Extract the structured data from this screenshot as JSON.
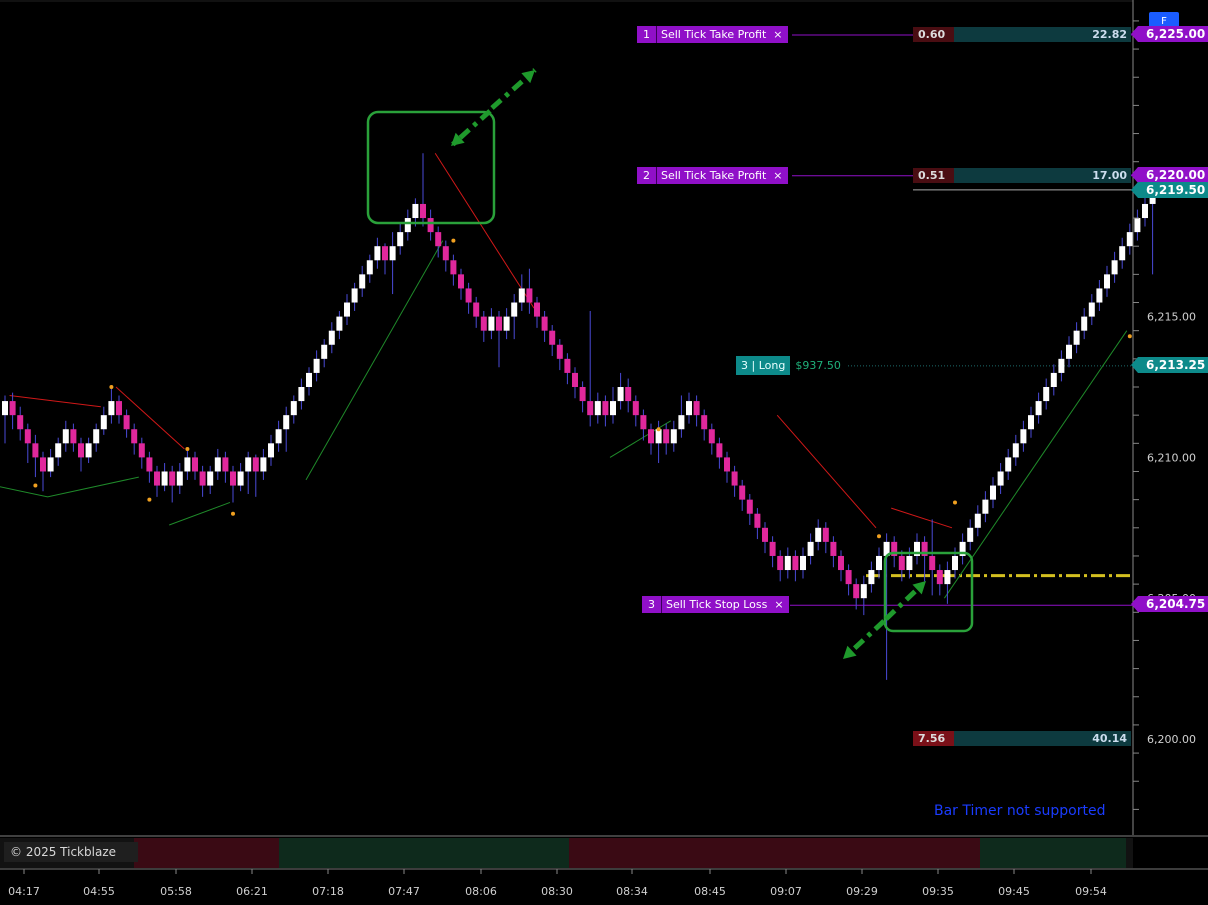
{
  "chart_data": {
    "type": "renko-candlestick",
    "instrument_price_axis": {
      "tick_labels": [
        "6,225.00",
        "6,220.00",
        "6,215.00",
        "6,210.00",
        "6,205.00",
        "6,200.00"
      ],
      "ticks": [
        6225,
        6220,
        6215,
        6210,
        6205,
        6200
      ],
      "ylim": [
        6198.2,
        6226.2
      ]
    },
    "time_axis": {
      "tick_labels": [
        "04:17",
        "04:55",
        "05:58",
        "06:21",
        "07:18",
        "07:47",
        "08:06",
        "08:30",
        "08:34",
        "08:45",
        "09:07",
        "09:29",
        "09:35",
        "09:45",
        "09:54"
      ]
    },
    "bars": [
      [
        6211.5,
        6212.0,
        6212.2,
        6210.5,
        "up"
      ],
      [
        6212.0,
        6211.5,
        6212.3,
        6211.0,
        "down"
      ],
      [
        6211.5,
        6211.0,
        6211.8,
        6210.6,
        "down"
      ],
      [
        6211.0,
        6210.5,
        6211.2,
        6209.8,
        "down"
      ],
      [
        6210.5,
        6210.0,
        6210.8,
        6209.3,
        "down"
      ],
      [
        6210.0,
        6209.5,
        6210.2,
        6208.8,
        "down"
      ],
      [
        6209.5,
        6210.0,
        6210.3,
        6209.3,
        "up"
      ],
      [
        6210.0,
        6210.5,
        6210.7,
        6209.7,
        "up"
      ],
      [
        6210.5,
        6211.0,
        6211.3,
        6210.2,
        "up"
      ],
      [
        6211.0,
        6210.5,
        6211.2,
        6210.2,
        "down"
      ],
      [
        6210.5,
        6210.0,
        6210.7,
        6209.5,
        "down"
      ],
      [
        6210.0,
        6210.5,
        6210.7,
        6209.8,
        "up"
      ],
      [
        6210.5,
        6211.0,
        6211.2,
        6210.2,
        "up"
      ],
      [
        6211.0,
        6211.5,
        6211.8,
        6210.8,
        "up"
      ],
      [
        6211.5,
        6212.0,
        6212.5,
        6211.2,
        "up"
      ],
      [
        6212.0,
        6211.5,
        6212.2,
        6211.2,
        "down"
      ],
      [
        6211.5,
        6211.0,
        6211.7,
        6210.7,
        "down"
      ],
      [
        6211.0,
        6210.5,
        6211.2,
        6210.1,
        "down"
      ],
      [
        6210.5,
        6210.0,
        6210.7,
        6209.6,
        "down"
      ],
      [
        6210.0,
        6209.5,
        6210.2,
        6209.1,
        "down"
      ],
      [
        6209.5,
        6209.0,
        6209.7,
        6208.6,
        "down"
      ],
      [
        6209.0,
        6209.5,
        6209.8,
        6208.8,
        "up"
      ],
      [
        6209.5,
        6209.0,
        6209.7,
        6208.4,
        "down"
      ],
      [
        6209.0,
        6209.5,
        6209.8,
        6208.7,
        "up"
      ],
      [
        6209.5,
        6210.0,
        6210.3,
        6209.2,
        "up"
      ],
      [
        6210.0,
        6209.5,
        6210.2,
        6209.2,
        "down"
      ],
      [
        6209.5,
        6209.0,
        6209.7,
        6208.6,
        "down"
      ],
      [
        6209.0,
        6209.5,
        6209.7,
        6208.7,
        "up"
      ],
      [
        6209.5,
        6210.0,
        6210.3,
        6209.2,
        "up"
      ],
      [
        6210.0,
        6209.5,
        6210.2,
        6209.1,
        "down"
      ],
      [
        6209.5,
        6209.0,
        6209.7,
        6208.4,
        "down"
      ],
      [
        6209.0,
        6209.5,
        6209.8,
        6208.8,
        "up"
      ],
      [
        6209.5,
        6210.0,
        6210.2,
        6208.7,
        "up"
      ],
      [
        6210.0,
        6209.5,
        6210.1,
        6208.6,
        "down"
      ],
      [
        6209.5,
        6210.0,
        6210.3,
        6209.2,
        "up"
      ],
      [
        6210.0,
        6210.5,
        6210.8,
        6209.7,
        "up"
      ],
      [
        6210.5,
        6211.0,
        6211.3,
        6210.2,
        "up"
      ],
      [
        6211.0,
        6211.5,
        6211.8,
        6210.2,
        "up"
      ],
      [
        6211.5,
        6212.0,
        6212.2,
        6211.2,
        "up"
      ],
      [
        6212.0,
        6212.5,
        6212.8,
        6211.7,
        "up"
      ],
      [
        6212.5,
        6213.0,
        6213.2,
        6212.2,
        "up"
      ],
      [
        6213.0,
        6213.5,
        6213.8,
        6212.7,
        "up"
      ],
      [
        6213.5,
        6214.0,
        6214.2,
        6213.2,
        "up"
      ],
      [
        6214.0,
        6214.5,
        6214.8,
        6213.7,
        "up"
      ],
      [
        6214.5,
        6215.0,
        6215.2,
        6214.2,
        "up"
      ],
      [
        6215.0,
        6215.5,
        6215.8,
        6214.7,
        "up"
      ],
      [
        6215.5,
        6216.0,
        6216.2,
        6215.2,
        "up"
      ],
      [
        6216.0,
        6216.5,
        6216.8,
        6215.7,
        "up"
      ],
      [
        6216.5,
        6217.0,
        6217.2,
        6216.2,
        "up"
      ],
      [
        6217.0,
        6217.5,
        6217.8,
        6216.7,
        "up"
      ],
      [
        6217.5,
        6217.0,
        6217.6,
        6216.5,
        "down"
      ],
      [
        6217.0,
        6217.5,
        6218.0,
        6215.8,
        "up"
      ],
      [
        6217.5,
        6218.0,
        6218.3,
        6217.2,
        "up"
      ],
      [
        6218.0,
        6218.5,
        6218.8,
        6217.7,
        "up"
      ],
      [
        6218.5,
        6219.0,
        6219.2,
        6218.2,
        "up"
      ],
      [
        6219.0,
        6218.5,
        6220.8,
        6218.2,
        "down"
      ],
      [
        6218.5,
        6218.0,
        6218.8,
        6217.7,
        "down"
      ],
      [
        6218.0,
        6217.5,
        6218.2,
        6217.1,
        "down"
      ],
      [
        6217.5,
        6217.0,
        6217.7,
        6216.6,
        "down"
      ],
      [
        6217.0,
        6216.5,
        6217.2,
        6216.1,
        "down"
      ],
      [
        6216.5,
        6216.0,
        6216.7,
        6215.6,
        "down"
      ],
      [
        6216.0,
        6215.5,
        6216.2,
        6215.1,
        "down"
      ],
      [
        6215.5,
        6215.0,
        6215.7,
        6214.6,
        "down"
      ],
      [
        6215.0,
        6214.5,
        6215.2,
        6214.1,
        "down"
      ],
      [
        6214.5,
        6215.0,
        6215.3,
        6214.2,
        "up"
      ],
      [
        6215.0,
        6214.5,
        6215.2,
        6213.2,
        "down"
      ],
      [
        6214.5,
        6215.0,
        6215.3,
        6214.2,
        "up"
      ],
      [
        6215.0,
        6215.5,
        6215.8,
        6214.2,
        "up"
      ],
      [
        6215.5,
        6216.0,
        6216.5,
        6215.2,
        "up"
      ],
      [
        6216.0,
        6215.5,
        6216.7,
        6215.1,
        "down"
      ],
      [
        6215.5,
        6215.0,
        6215.7,
        6214.6,
        "down"
      ],
      [
        6215.0,
        6214.5,
        6215.2,
        6214.1,
        "down"
      ],
      [
        6214.5,
        6214.0,
        6214.7,
        6213.6,
        "down"
      ],
      [
        6214.0,
        6213.5,
        6214.2,
        6213.1,
        "down"
      ],
      [
        6213.5,
        6213.0,
        6213.7,
        6212.6,
        "down"
      ],
      [
        6213.0,
        6212.5,
        6213.2,
        6212.1,
        "down"
      ],
      [
        6212.5,
        6212.0,
        6212.7,
        6211.6,
        "down"
      ],
      [
        6212.0,
        6211.5,
        6215.2,
        6211.1,
        "down"
      ],
      [
        6211.5,
        6212.0,
        6212.3,
        6211.2,
        "up"
      ],
      [
        6212.0,
        6211.5,
        6212.2,
        6211.1,
        "down"
      ],
      [
        6211.5,
        6212.0,
        6212.5,
        6211.2,
        "up"
      ],
      [
        6212.0,
        6212.5,
        6213.0,
        6211.7,
        "up"
      ],
      [
        6212.5,
        6212.0,
        6212.8,
        6211.6,
        "down"
      ],
      [
        6212.0,
        6211.5,
        6212.2,
        6211.1,
        "down"
      ],
      [
        6211.5,
        6211.0,
        6211.7,
        6210.6,
        "down"
      ],
      [
        6211.0,
        6210.5,
        6211.2,
        6210.1,
        "down"
      ],
      [
        6210.5,
        6211.0,
        6211.3,
        6209.8,
        "up"
      ],
      [
        6211.0,
        6210.5,
        6211.2,
        6210.1,
        "down"
      ],
      [
        6210.5,
        6211.0,
        6211.3,
        6210.2,
        "up"
      ],
      [
        6211.0,
        6211.5,
        6212.2,
        6210.7,
        "up"
      ],
      [
        6211.5,
        6212.0,
        6212.3,
        6211.2,
        "up"
      ],
      [
        6212.0,
        6211.5,
        6212.2,
        6211.1,
        "down"
      ],
      [
        6211.5,
        6211.0,
        6211.7,
        6210.6,
        "down"
      ],
      [
        6211.0,
        6210.5,
        6211.2,
        6210.1,
        "down"
      ],
      [
        6210.5,
        6210.0,
        6210.7,
        6209.6,
        "down"
      ],
      [
        6210.0,
        6209.5,
        6210.2,
        6209.1,
        "down"
      ],
      [
        6209.5,
        6209.0,
        6209.7,
        6208.6,
        "down"
      ],
      [
        6209.0,
        6208.5,
        6209.2,
        6208.1,
        "down"
      ],
      [
        6208.5,
        6208.0,
        6208.7,
        6207.6,
        "down"
      ],
      [
        6208.0,
        6207.5,
        6208.2,
        6207.1,
        "down"
      ],
      [
        6207.5,
        6207.0,
        6207.7,
        6206.6,
        "down"
      ],
      [
        6207.0,
        6206.5,
        6207.2,
        6206.1,
        "down"
      ],
      [
        6206.5,
        6206.0,
        6206.7,
        6205.6,
        "down"
      ],
      [
        6206.0,
        6206.5,
        6206.8,
        6205.7,
        "up"
      ],
      [
        6206.5,
        6206.0,
        6206.7,
        6205.6,
        "down"
      ],
      [
        6206.0,
        6206.5,
        6206.8,
        6205.7,
        "up"
      ],
      [
        6206.5,
        6207.0,
        6207.3,
        6206.2,
        "up"
      ],
      [
        6207.0,
        6207.5,
        6207.8,
        6206.7,
        "up"
      ],
      [
        6207.5,
        6207.0,
        6207.7,
        6206.6,
        "down"
      ],
      [
        6207.0,
        6206.5,
        6207.2,
        6206.1,
        "down"
      ],
      [
        6206.5,
        6206.0,
        6206.7,
        6205.6,
        "down"
      ],
      [
        6206.0,
        6205.5,
        6206.2,
        6205.1,
        "down"
      ],
      [
        6205.5,
        6205.0,
        6205.7,
        6204.6,
        "down"
      ],
      [
        6205.0,
        6205.5,
        6205.8,
        6204.4,
        "up"
      ],
      [
        6205.5,
        6206.0,
        6206.3,
        6205.2,
        "up"
      ],
      [
        6206.0,
        6206.5,
        6206.8,
        6205.7,
        "up"
      ],
      [
        6206.5,
        6207.0,
        6207.3,
        6202.1,
        "up"
      ],
      [
        6207.0,
        6206.5,
        6207.2,
        6206.1,
        "down"
      ],
      [
        6206.5,
        6206.0,
        6206.7,
        6205.6,
        "down"
      ],
      [
        6206.0,
        6206.5,
        6206.8,
        6205.7,
        "up"
      ],
      [
        6206.5,
        6207.0,
        6207.3,
        6206.2,
        "up"
      ],
      [
        6207.0,
        6206.5,
        6207.2,
        6205.6,
        "down"
      ],
      [
        6206.5,
        6206.0,
        6207.8,
        6205.1,
        "down"
      ],
      [
        6206.0,
        6205.5,
        6206.2,
        6205.1,
        "down"
      ],
      [
        6205.5,
        6206.0,
        6206.3,
        6204.8,
        "up"
      ],
      [
        6206.0,
        6206.5,
        6206.8,
        6205.7,
        "up"
      ],
      [
        6206.5,
        6207.0,
        6207.3,
        6206.2,
        "up"
      ],
      [
        6207.0,
        6207.5,
        6207.8,
        6206.7,
        "up"
      ],
      [
        6207.5,
        6208.0,
        6208.3,
        6207.2,
        "up"
      ],
      [
        6208.0,
        6208.5,
        6208.8,
        6207.7,
        "up"
      ],
      [
        6208.5,
        6209.0,
        6209.3,
        6208.2,
        "up"
      ],
      [
        6209.0,
        6209.5,
        6209.8,
        6208.7,
        "up"
      ],
      [
        6209.5,
        6210.0,
        6210.3,
        6209.2,
        "up"
      ],
      [
        6210.0,
        6210.5,
        6210.8,
        6209.7,
        "up"
      ],
      [
        6210.5,
        6211.0,
        6211.3,
        6210.2,
        "up"
      ],
      [
        6211.0,
        6211.5,
        6211.8,
        6210.7,
        "up"
      ],
      [
        6211.5,
        6212.0,
        6212.3,
        6211.2,
        "up"
      ],
      [
        6212.0,
        6212.5,
        6212.8,
        6211.7,
        "up"
      ],
      [
        6212.5,
        6213.0,
        6213.3,
        6212.2,
        "up"
      ],
      [
        6213.0,
        6213.5,
        6213.8,
        6212.7,
        "up"
      ],
      [
        6213.5,
        6214.0,
        6214.3,
        6213.2,
        "up"
      ],
      [
        6214.0,
        6214.5,
        6214.8,
        6213.7,
        "up"
      ],
      [
        6214.5,
        6215.0,
        6215.3,
        6214.2,
        "up"
      ],
      [
        6215.0,
        6215.5,
        6215.8,
        6214.7,
        "up"
      ],
      [
        6215.5,
        6216.0,
        6216.3,
        6215.2,
        "up"
      ],
      [
        6216.0,
        6216.5,
        6216.8,
        6215.7,
        "up"
      ],
      [
        6216.5,
        6217.0,
        6217.3,
        6216.2,
        "up"
      ],
      [
        6217.0,
        6217.5,
        6217.8,
        6216.7,
        "up"
      ],
      [
        6217.5,
        6218.0,
        6218.3,
        6217.2,
        "up"
      ],
      [
        6218.0,
        6218.5,
        6218.8,
        6217.7,
        "up"
      ],
      [
        6218.5,
        6219.0,
        6219.3,
        6218.2,
        "up"
      ],
      [
        6219.0,
        6219.5,
        6219.8,
        6216.5,
        "up"
      ]
    ],
    "bar_value_order": [
      "open",
      "close",
      "high",
      "low",
      "direction"
    ],
    "colors": {
      "up": "#ffffff",
      "down": "#e0289c",
      "background": "#000000"
    },
    "orders": [
      {
        "id": "1",
        "label": "Sell Tick Take Profit",
        "price": 6225.0,
        "price_label": "6,225.00",
        "pnl_left": "0.60",
        "pnl_right": "22.82"
      },
      {
        "id": "2",
        "label": "Sell Tick Take Profit",
        "price": 6220.0,
        "price_label": "6,220.00",
        "pnl_left": "0.51",
        "pnl_right": "17.00"
      },
      {
        "id": "3",
        "label": "Sell Tick Stop Loss",
        "price": 6204.75,
        "price_label": "6,204.75",
        "pnl_left": "7.56",
        "pnl_right": "40.14"
      }
    ],
    "position": {
      "label": "3 | Long",
      "pnl": "$937.50",
      "price": 6213.25,
      "price_label": "6,213.25"
    },
    "last_price": {
      "price": 6219.5,
      "price_label": "6,219.50"
    },
    "entry_line_price": 6205.8,
    "order_color": "#9010c8",
    "position_color": "#0d8a8a",
    "session_colors": [
      "#3a0a14",
      "#0e2a1c"
    ]
  },
  "ui": {
    "watermark": "© 2025 Tickblaze",
    "bar_timer": "Bar Timer not supported",
    "f_badge": "F",
    "close_glyph": "×"
  }
}
